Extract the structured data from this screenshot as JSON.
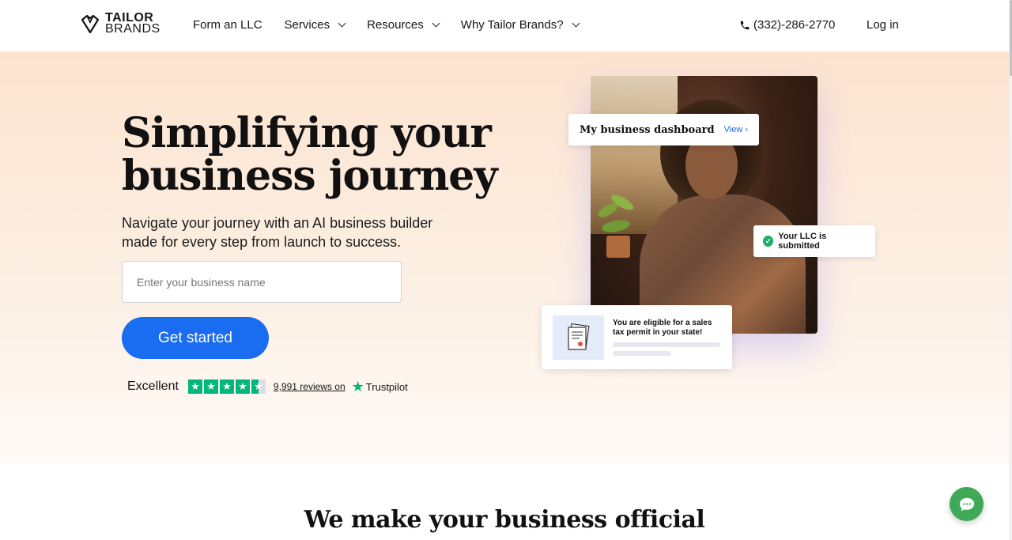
{
  "header": {
    "logo_line1": "TAILOR",
    "logo_line2": "BRANDS",
    "nav": [
      {
        "label": "Form an LLC",
        "dropdown": false
      },
      {
        "label": "Services",
        "dropdown": true
      },
      {
        "label": "Resources",
        "dropdown": true
      },
      {
        "label": "Why Tailor Brands?",
        "dropdown": true
      }
    ],
    "phone": "(332)-286-2770",
    "login": "Log in"
  },
  "hero": {
    "title": "Simplifying your business journey",
    "subtitle": "Navigate your journey with an AI business builder made for every step from launch to success.",
    "input_placeholder": "Enter your business name",
    "cta": "Get started",
    "trustpilot": {
      "rating_text": "Excellent",
      "stars": 4.5,
      "reviews": "9,991 reviews on",
      "brand": "Trustpilot"
    },
    "cards": {
      "dashboard_title": "My business dashboard",
      "dashboard_link": "View",
      "llc_status": "Your LLC is submitted",
      "tax_text": "You are eligible for a sales tax permit in your state!"
    }
  },
  "section2": {
    "title": "We make your business official"
  },
  "colors": {
    "accent": "#1a6cf0",
    "trustpilot_green": "#00b67a",
    "chat_green": "#3fa957"
  }
}
